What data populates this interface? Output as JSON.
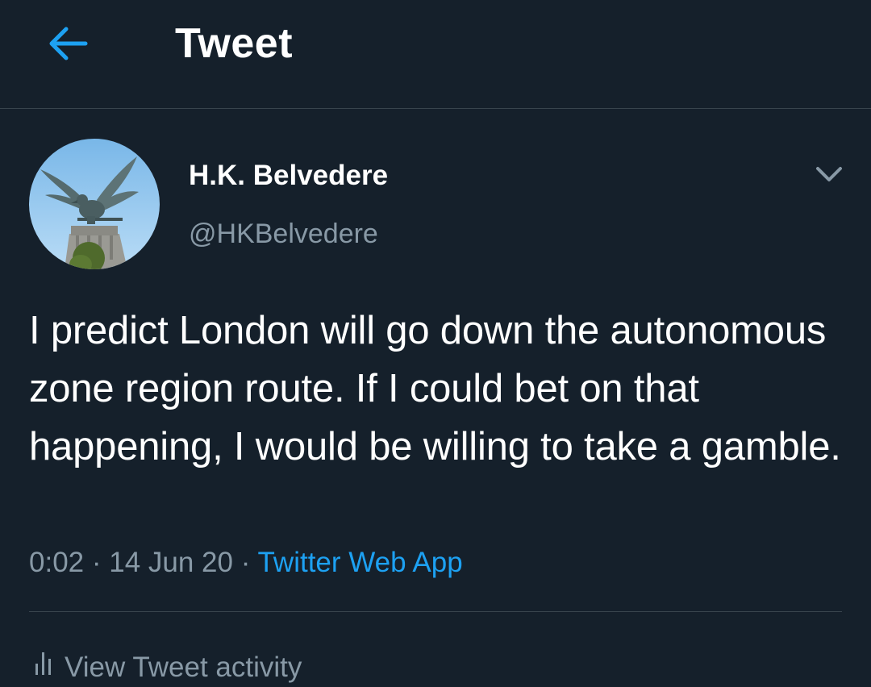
{
  "header": {
    "title": "Tweet",
    "back_icon": "arrow-left-icon",
    "accent_color": "#1da1f2"
  },
  "tweet": {
    "author": {
      "display_name": "H.K. Belvedere",
      "handle": "@HKBelvedere",
      "avatar": "eagle-statue-avatar"
    },
    "menu_icon": "chevron-down-icon",
    "text": "I predict London will go down the autonomous zone region route. If I could bet on that happening, I would be willing to take a gamble.",
    "time": "0:02",
    "separator": "·",
    "date": "14 Jun 20",
    "source": "Twitter Web App"
  },
  "activity": {
    "label": "View Tweet activity",
    "icon": "bar-chart-icon"
  },
  "theme": {
    "background": "#15202b",
    "secondary_text": "#8899a6",
    "border": "#38444d"
  }
}
